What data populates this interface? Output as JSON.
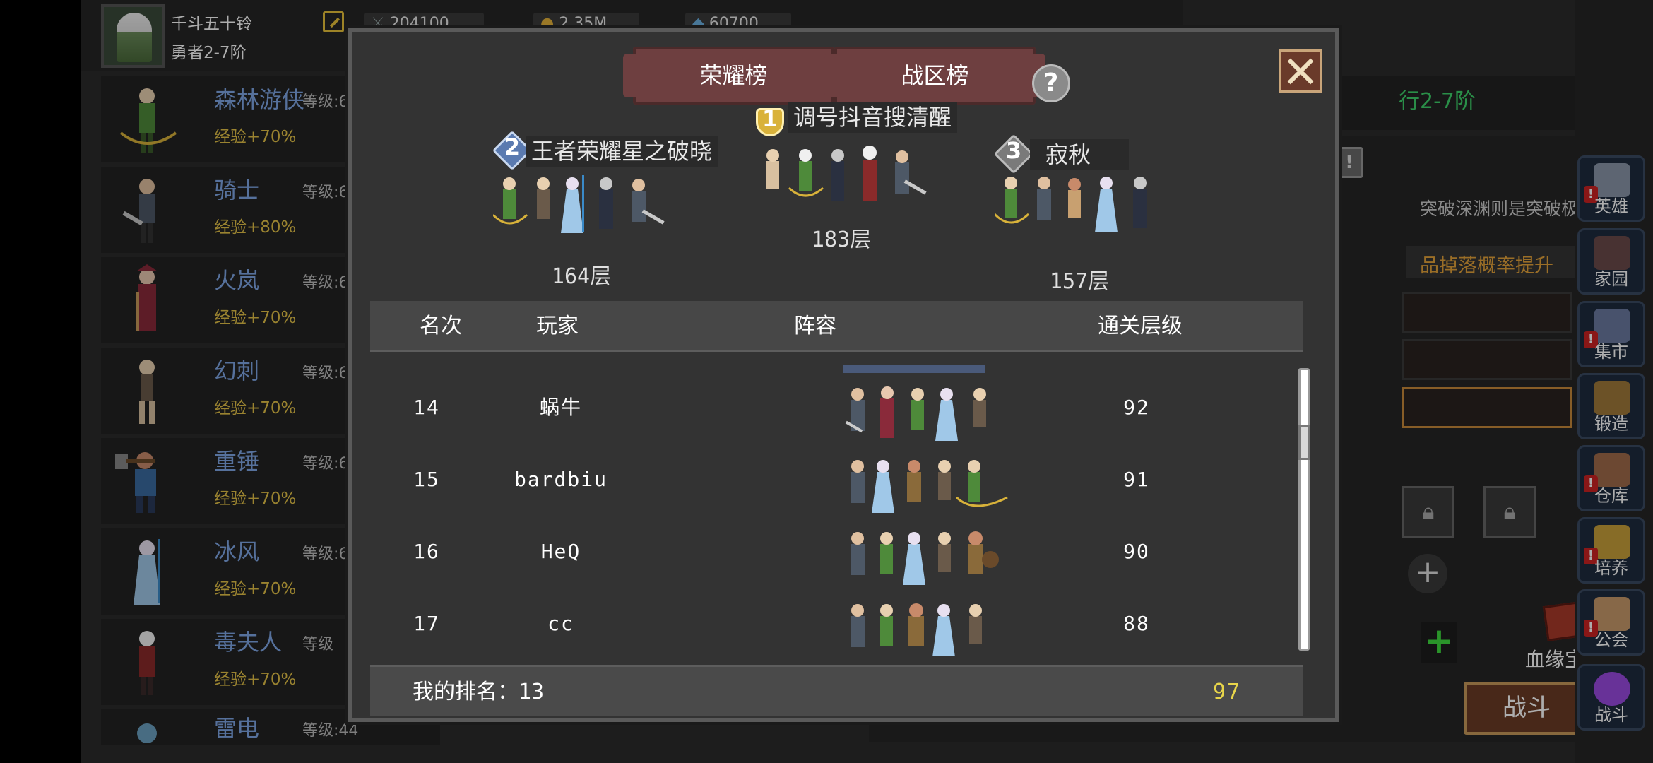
{
  "player": {
    "name": "千斗五十铃",
    "rank": "勇者2-7阶"
  },
  "resources": [
    {
      "icon": "sword-icon",
      "value": "204100"
    },
    {
      "icon": "gold-coin-icon",
      "value": "2.35M"
    },
    {
      "icon": "gem-icon",
      "value": "60700"
    }
  ],
  "heroes": [
    {
      "name": "森林游侠",
      "level": "等级:6",
      "exp": "经验+70%",
      "color": "#4e8a3a"
    },
    {
      "name": "骑士",
      "level": "等级:6",
      "exp": "经验+80%",
      "color": "#4d5866"
    },
    {
      "name": "火岚",
      "level": "等级:6",
      "exp": "经验+70%",
      "color": "#8a2a3a"
    },
    {
      "name": "幻刺",
      "level": "等级:6",
      "exp": "经验+70%",
      "color": "#6a5a4a"
    },
    {
      "name": "重锤",
      "level": "等级:6",
      "exp": "经验+70%",
      "color": "#3a6aa0"
    },
    {
      "name": "冰风",
      "level": "等级:6",
      "exp": "经验+70%",
      "color": "#6ab0e0"
    },
    {
      "name": "毒夫人",
      "level": "等级",
      "exp": "经验+70%",
      "color": "#8a2a2a"
    },
    {
      "name": "雷电",
      "level": "等级:44",
      "exp": "",
      "color": "#6aa0c0"
    }
  ],
  "right_panel": {
    "stage_label": "行2-7阶",
    "info_text": "突破深渊则是突破极限",
    "drop_text": "品掉落概率提升",
    "bloodline_label": "血缘宝典",
    "fight_label": "战斗"
  },
  "side_menu": [
    {
      "label": "英雄",
      "icon": "helmet-icon",
      "alert": true,
      "color": "#8a96a8"
    },
    {
      "label": "家园",
      "icon": "castle-icon",
      "alert": false,
      "color": "#6a4a4a"
    },
    {
      "label": "集市",
      "icon": "market-icon",
      "alert": true,
      "color": "#6a7aa0"
    },
    {
      "label": "锻造",
      "icon": "anvil-icon",
      "alert": false,
      "color": "#a07a3a"
    },
    {
      "label": "仓库",
      "icon": "chest-icon",
      "alert": true,
      "color": "#a06a4a"
    },
    {
      "label": "培养",
      "icon": "trophy-icon",
      "alert": true,
      "color": "#c8a03a"
    },
    {
      "label": "公会",
      "icon": "guild-icon",
      "alert": true,
      "color": "#c89a6a"
    },
    {
      "label": "战斗",
      "icon": "portal-icon",
      "alert": false,
      "color": "#9a4ae0"
    }
  ],
  "leaderboard": {
    "tabs": [
      "荣耀榜",
      "战区榜"
    ],
    "help_symbol": "?",
    "podium": [
      {
        "rank": "1",
        "name": "调号抖音搜清醒",
        "floor": "183层",
        "badge_color": "#d9b23a"
      },
      {
        "rank": "2",
        "name": "王者荣耀星之破晓",
        "floor": "164层",
        "badge_color": "#5a7ab0"
      },
      {
        "rank": "3",
        "name": "寂秋",
        "floor": "157层",
        "badge_color": "#8a8a8a"
      }
    ],
    "columns": {
      "rank": "名次",
      "player": "玩家",
      "lineup": "阵容",
      "floor": "通关层级"
    },
    "rows": [
      {
        "rank": "14",
        "player": "蜗牛",
        "floor": "92"
      },
      {
        "rank": "15",
        "player": "bardbiu",
        "floor": "91"
      },
      {
        "rank": "16",
        "player": "HeQ",
        "floor": "90"
      },
      {
        "rank": "17",
        "player": "cc",
        "floor": "88"
      }
    ],
    "my_rank_label": "我的排名：13",
    "my_floor": "97"
  },
  "colors": {
    "hero_name": "#7fa7e6",
    "exp_text": "#e3c247",
    "tab_bg": "#6e3f40",
    "my_floor": "#e8d54a",
    "stage_green": "#3ed26a"
  }
}
